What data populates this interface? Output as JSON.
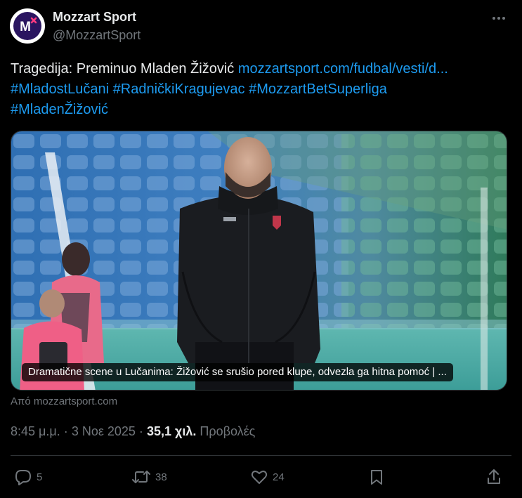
{
  "account": {
    "display_name": "Mozzart Sport",
    "handle": "@MozzartSport",
    "avatar_icon": "mozzart-logo-icon"
  },
  "tweet": {
    "text_intro": "Tragedija: Preminuo Mladen Žižović",
    "link": "mozzartsport.com/fudbal/vesti/d...",
    "hashtags": [
      "#MladostLučani",
      "#RadničkiKragujevac",
      "#MozzartBetSuperliga",
      "#MladenŽižović"
    ]
  },
  "media": {
    "caption": "Dramatične scene u Lučanima: Žižović se srušio pored klupe, odvezla ga hitna pomoć | ...",
    "source": "Από mozzartsport.com"
  },
  "meta": {
    "time": "8:45 μ.μ.",
    "date": "3 Νοε 2025",
    "views_count": "35,1 χιλ.",
    "views_label": "Προβολές"
  },
  "actions": {
    "replies": "5",
    "reposts": "38",
    "likes": "24"
  },
  "colors": {
    "background": "#000000",
    "text": "#e7e9ea",
    "secondary": "#71767b",
    "link": "#1d9bf0",
    "divider": "#2f3336"
  }
}
